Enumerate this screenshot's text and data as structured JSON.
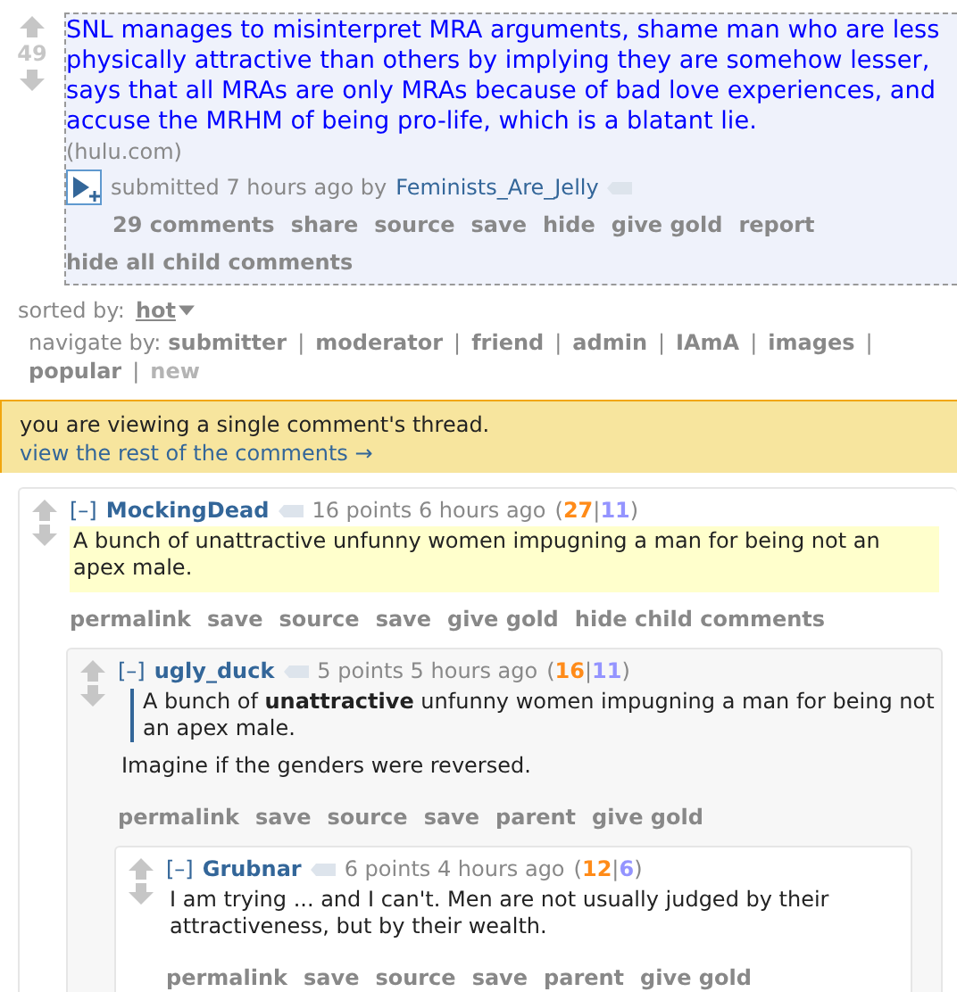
{
  "post": {
    "score": "49",
    "title": "SNL manages to misinterpret MRA arguments, shame man who are less physically attractive than others by implying they are somehow lesser, says that all MRAs are only MRAs because of bad love experiences, and accuse the MRHM of being pro-life, which is a blatant lie.",
    "domain": "(hulu.com)",
    "tagline": "submitted 7 hours ago by",
    "author": "Feminists_Are_Jelly",
    "actions": [
      "29 comments",
      "share",
      "source",
      "save",
      "hide",
      "give gold",
      "report"
    ],
    "extra_action": "hide all child comments"
  },
  "sort": {
    "label": "sorted by:",
    "value": "hot"
  },
  "navigate": {
    "label": "navigate by:",
    "separator": "|",
    "items": [
      {
        "label": "submitter",
        "disabled": false
      },
      {
        "label": "moderator",
        "disabled": false
      },
      {
        "label": "friend",
        "disabled": false
      },
      {
        "label": "admin",
        "disabled": false
      },
      {
        "label": "IAmA",
        "disabled": false
      },
      {
        "label": "images",
        "disabled": false
      },
      {
        "label": "popular",
        "disabled": false
      },
      {
        "label": "new",
        "disabled": true
      }
    ]
  },
  "notice": {
    "text": "you are viewing a single comment's thread.",
    "link": "view the rest of the comments →"
  },
  "comments": [
    {
      "toggle": "[–]",
      "author": "MockingDead",
      "meta": "16 points 6 hours ago",
      "votes": {
        "open": "(",
        "up": "27",
        "sep": "|",
        "down": "11",
        "close": ")"
      },
      "highlighted": true,
      "body": [
        {
          "kind": "text",
          "text": "A bunch of unattractive unfunny women impugning a man for being not an apex male."
        }
      ],
      "actions": [
        "permalink",
        "save",
        "source",
        "save",
        "give gold",
        "hide child comments"
      ],
      "children": [
        {
          "toggle": "[–]",
          "author": "ugly_duck",
          "meta": "5 points 5 hours ago",
          "votes": {
            "open": "(",
            "up": "16",
            "sep": "|",
            "down": "11",
            "close": ")"
          },
          "highlighted": false,
          "body": [
            {
              "kind": "quote",
              "text": "A bunch of **unattractive** unfunny women impugning a man for being not an apex male."
            },
            {
              "kind": "text",
              "text": "Imagine if the genders were reversed."
            }
          ],
          "actions": [
            "permalink",
            "save",
            "source",
            "save",
            "parent",
            "give gold"
          ],
          "children": [
            {
              "toggle": "[–]",
              "author": "Grubnar",
              "meta": "6 points 4 hours ago",
              "votes": {
                "open": "(",
                "up": "12",
                "sep": "|",
                "down": "6",
                "close": ")"
              },
              "highlighted": false,
              "body": [
                {
                  "kind": "text",
                  "text": "I am trying ... and I can't. Men are not usually judged by their attractiveness, but by their wealth."
                }
              ],
              "actions": [
                "permalink",
                "save",
                "source",
                "save",
                "parent",
                "give gold"
              ]
            }
          ]
        }
      ]
    }
  ]
}
